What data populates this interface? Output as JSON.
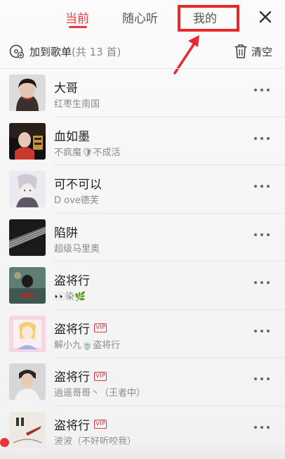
{
  "tabs": [
    {
      "label": "当前",
      "active": true
    },
    {
      "label": "随心听",
      "active": false
    },
    {
      "label": "我的",
      "active": false
    }
  ],
  "actions": {
    "add_label": "加到歌单",
    "count_label": "(共 13 首)",
    "clear_label": "清空"
  },
  "colors": {
    "accent": "#e8373b",
    "highlight": "#e8282a"
  },
  "songs": [
    {
      "title": "大哥",
      "artist": "红枣生南国",
      "badge": ""
    },
    {
      "title": "血如墨",
      "artist": "不疯魔🛡不成活",
      "badge": ""
    },
    {
      "title": "可不可以",
      "artist": "D ove德芙",
      "badge": ""
    },
    {
      "title": "陷阱",
      "artist": "超级马里奥",
      "badge": ""
    },
    {
      "title": "盗将行",
      "artist": "👀染🌿",
      "badge": ""
    },
    {
      "title": "盗将行",
      "artist": "解小九🍵盗将行",
      "badge": "VIP"
    },
    {
      "title": "盗将行",
      "artist": "逍遥哥哥丶（王者中）",
      "badge": "VIP"
    },
    {
      "title": "盗将行",
      "artist": "波波（不好听咬我）",
      "badge": "VIP"
    }
  ]
}
